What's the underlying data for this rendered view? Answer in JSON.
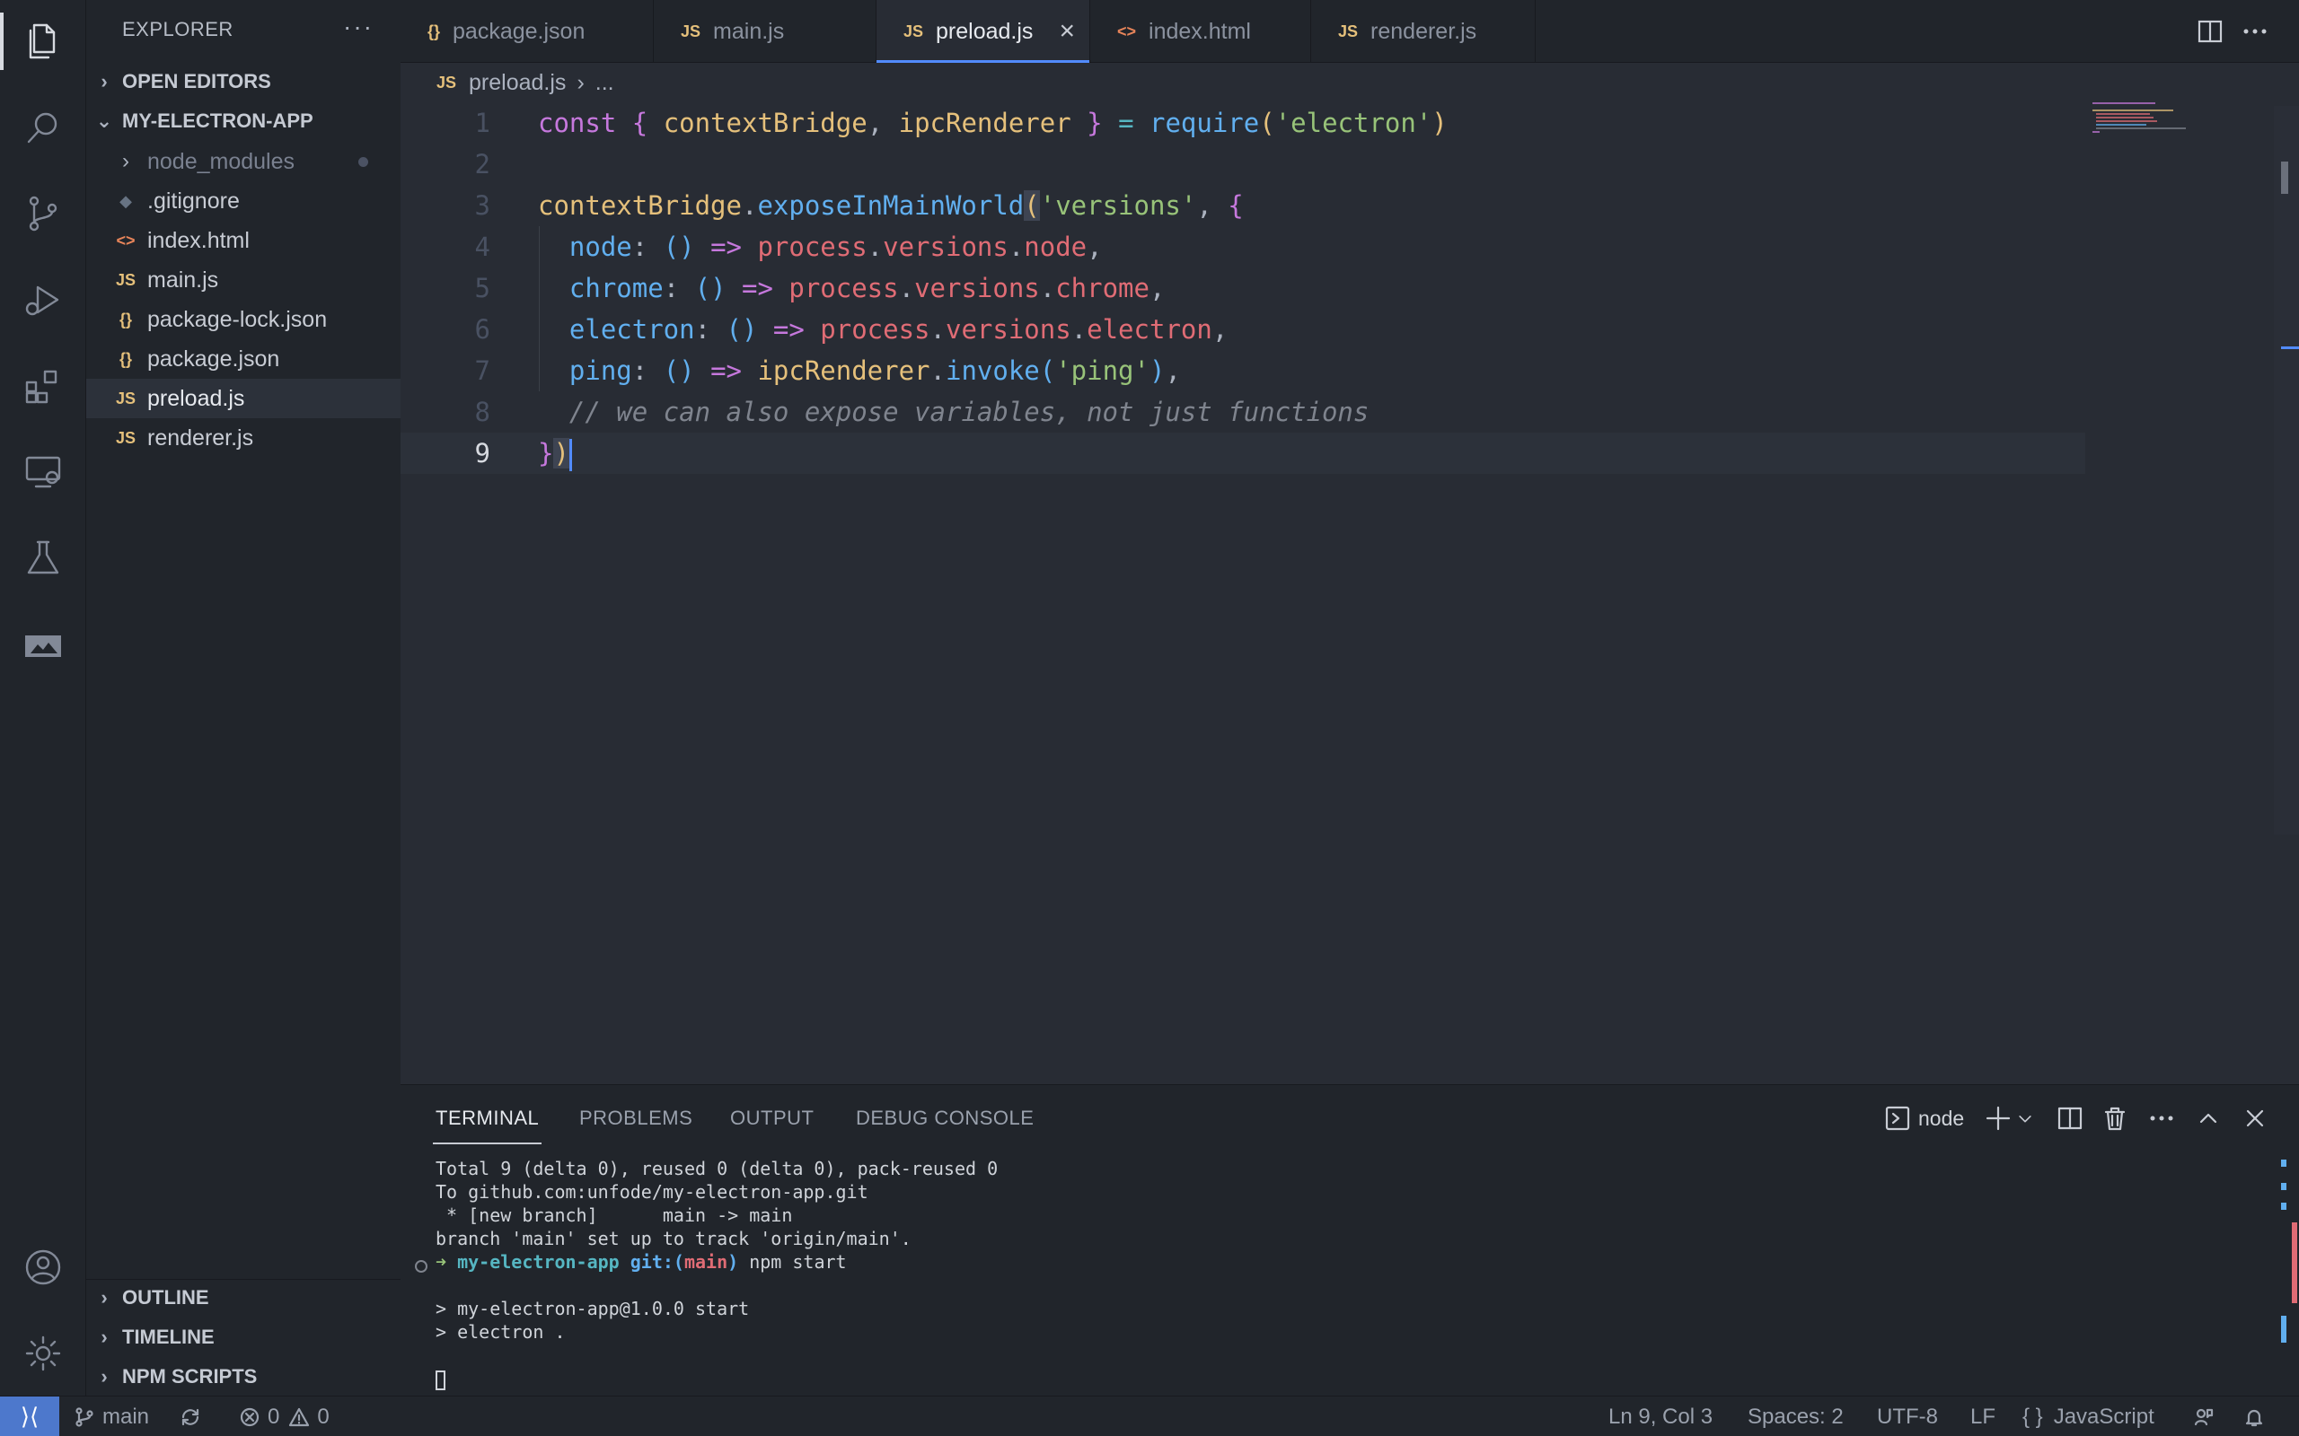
{
  "sidebar": {
    "title": "EXPLORER",
    "more": "···",
    "sections": {
      "open_editors": "OPEN EDITORS",
      "project": "MY-ELECTRON-APP",
      "outline": "OUTLINE",
      "timeline": "TIMELINE",
      "npm_scripts": "NPM SCRIPTS"
    },
    "files": [
      {
        "name": "node_modules",
        "icon": "folder-chevron"
      },
      {
        "name": ".gitignore",
        "icon": "git-icon"
      },
      {
        "name": "index.html",
        "icon": "html-icon"
      },
      {
        "name": "main.js",
        "icon": "js-icon"
      },
      {
        "name": "package-lock.json",
        "icon": "json-icon"
      },
      {
        "name": "package.json",
        "icon": "json-icon"
      },
      {
        "name": "preload.js",
        "icon": "js-icon"
      },
      {
        "name": "renderer.js",
        "icon": "js-icon"
      }
    ],
    "icon_labels": {
      "js": "JS",
      "json": "{}",
      "html": "<>",
      "git": "◆",
      "chev_right": "›",
      "chev_down": "⌄"
    }
  },
  "tabs": [
    {
      "label": "package.json",
      "icon": "{}"
    },
    {
      "label": "main.js",
      "icon": "JS"
    },
    {
      "label": "preload.js",
      "icon": "JS",
      "close": "×"
    },
    {
      "label": "index.html",
      "icon": "<>"
    },
    {
      "label": "renderer.js",
      "icon": "JS"
    }
  ],
  "breadcrumb": {
    "icon": "JS",
    "file": "preload.js",
    "sep": "›",
    "rest": "..."
  },
  "editor": {
    "line_numbers": [
      "1",
      "2",
      "3",
      "4",
      "5",
      "6",
      "7",
      "8",
      "9"
    ],
    "code": {
      "l1": {
        "kw": "const",
        "b1": " { ",
        "v1": "contextBridge",
        "c1": ", ",
        "v2": "ipcRenderer",
        "b2": " } ",
        "eq": "=",
        "sp": " ",
        "fn": "require",
        "po": "(",
        "str": "'electron'",
        "pc": ")"
      },
      "l3": {
        "obj": "contextBridge",
        "dot": ".",
        "fn": "exposeInMainWorld",
        "po": "(",
        "str": "'versions'",
        "c": ", ",
        "br": "{"
      },
      "l4": {
        "key": "node",
        "col": ": ",
        "pp": "()",
        "arr": " => ",
        "obj": "process",
        "d1": ".",
        "p1": "versions",
        "d2": ".",
        "p2": "node",
        "end": ","
      },
      "l5": {
        "key": "chrome",
        "col": ": ",
        "pp": "()",
        "arr": " => ",
        "obj": "process",
        "d1": ".",
        "p1": "versions",
        "d2": ".",
        "p2": "chrome",
        "end": ","
      },
      "l6": {
        "key": "electron",
        "col": ": ",
        "pp": "()",
        "arr": " => ",
        "obj": "process",
        "d1": ".",
        "p1": "versions",
        "d2": ".",
        "p2": "electron",
        "end": ","
      },
      "l7": {
        "key": "ping",
        "col": ": ",
        "pp": "()",
        "arr": " => ",
        "obj": "ipcRenderer",
        "d1": ".",
        "fn": "invoke",
        "po": "(",
        "str": "'ping'",
        "pc": ")",
        "end": ","
      },
      "l8": {
        "comment": "// we can also expose variables, not just functions"
      },
      "l9": {
        "br": "}",
        "pc": ")"
      }
    }
  },
  "panel": {
    "tabs": [
      "TERMINAL",
      "PROBLEMS",
      "OUTPUT",
      "DEBUG CONSOLE"
    ],
    "shell_label": "node",
    "terminal": {
      "l1": "Total 9 (delta 0), reused 0 (delta 0), pack-reused 0",
      "l2": "To github.com:unfode/my-electron-app.git",
      "l3": " * [new branch]      main -> main",
      "l4": "branch 'main' set up to track 'origin/main'.",
      "prompt_arrow": "➜ ",
      "prompt_dir": "my-electron-app",
      "prompt_git": " git:(",
      "prompt_branch": "main",
      "prompt_close": ")",
      "prompt_cmd": " npm start",
      "l6": "> my-electron-app@1.0.0 start",
      "l7": "> electron ."
    }
  },
  "statusbar": {
    "remote": "⟩⟨",
    "branch": "main",
    "errors": "0",
    "warnings": "0",
    "position": "Ln 9, Col 3",
    "spaces": "Spaces: 2",
    "encoding": "UTF-8",
    "eol": "LF",
    "language_icon": "{ }",
    "language": "JavaScript"
  },
  "colors": {
    "accent": "#528bff",
    "remote": "#4d78cc",
    "background": "#282c34",
    "sidebar": "#21252b"
  }
}
